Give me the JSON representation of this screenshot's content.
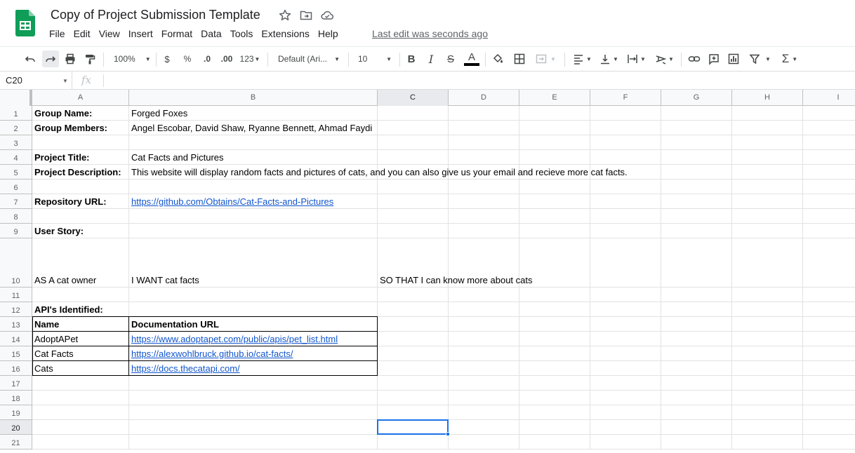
{
  "app": {
    "title": "Copy of Project Submission Template",
    "brand_color": "#0f9d58",
    "menu": [
      "File",
      "Edit",
      "View",
      "Insert",
      "Format",
      "Data",
      "Tools",
      "Extensions",
      "Help"
    ],
    "last_edit": "Last edit was seconds ago"
  },
  "toolbar": {
    "zoom": "100%",
    "currency": "$",
    "percent": "%",
    "decrease_decimal": ".0",
    "increase_decimal": ".00",
    "more_formats": "123",
    "font": "Default (Ari...",
    "font_size": "10",
    "bold": "B",
    "italic": "I",
    "strikethrough": "S",
    "text_color": "A"
  },
  "formula_bar": {
    "name_box": "C20",
    "fx": "fx",
    "value": ""
  },
  "grid": {
    "columns": [
      "A",
      "B",
      "C",
      "D",
      "E",
      "F",
      "G",
      "H",
      "I"
    ],
    "selected_column": "C",
    "rows": [
      "1",
      "2",
      "3",
      "4",
      "5",
      "6",
      "7",
      "8",
      "9",
      "10",
      "11",
      "12",
      "13",
      "14",
      "15",
      "16",
      "17",
      "18",
      "19",
      "20",
      "21"
    ],
    "selected_row": "20",
    "selected_cell": "C20",
    "cells": {
      "A1": "Group Name:",
      "B1": "Forged Foxes",
      "A2": "Group Members:",
      "B2": "Angel Escobar, David Shaw, Ryanne Bennett, Ahmad Faydi",
      "A4": "Project Title:",
      "B4": "Cat Facts and Pictures",
      "A5": "Project Description:",
      "B5": "This website will display random facts and pictures of cats, and you can also give us your email and recieve more cat facts.",
      "A7": "Repository URL:",
      "B7": "https://github.com/Obtains/Cat-Facts-and-Pictures",
      "A9": "User Story:",
      "A10": "AS A cat owner",
      "B10": "I WANT cat facts",
      "C10": "SO THAT I can know more about cats",
      "A12": "API's Identified:",
      "A13": "Name",
      "B13": "Documentation URL",
      "A14": "AdoptAPet",
      "B14": "https://www.adoptapet.com/public/apis/pet_list.html",
      "A15": "Cat Facts",
      "B15": "https://alexwohlbruck.github.io/cat-facts/",
      "A16": "Cats",
      "B16": "https://docs.thecatapi.com/"
    }
  }
}
